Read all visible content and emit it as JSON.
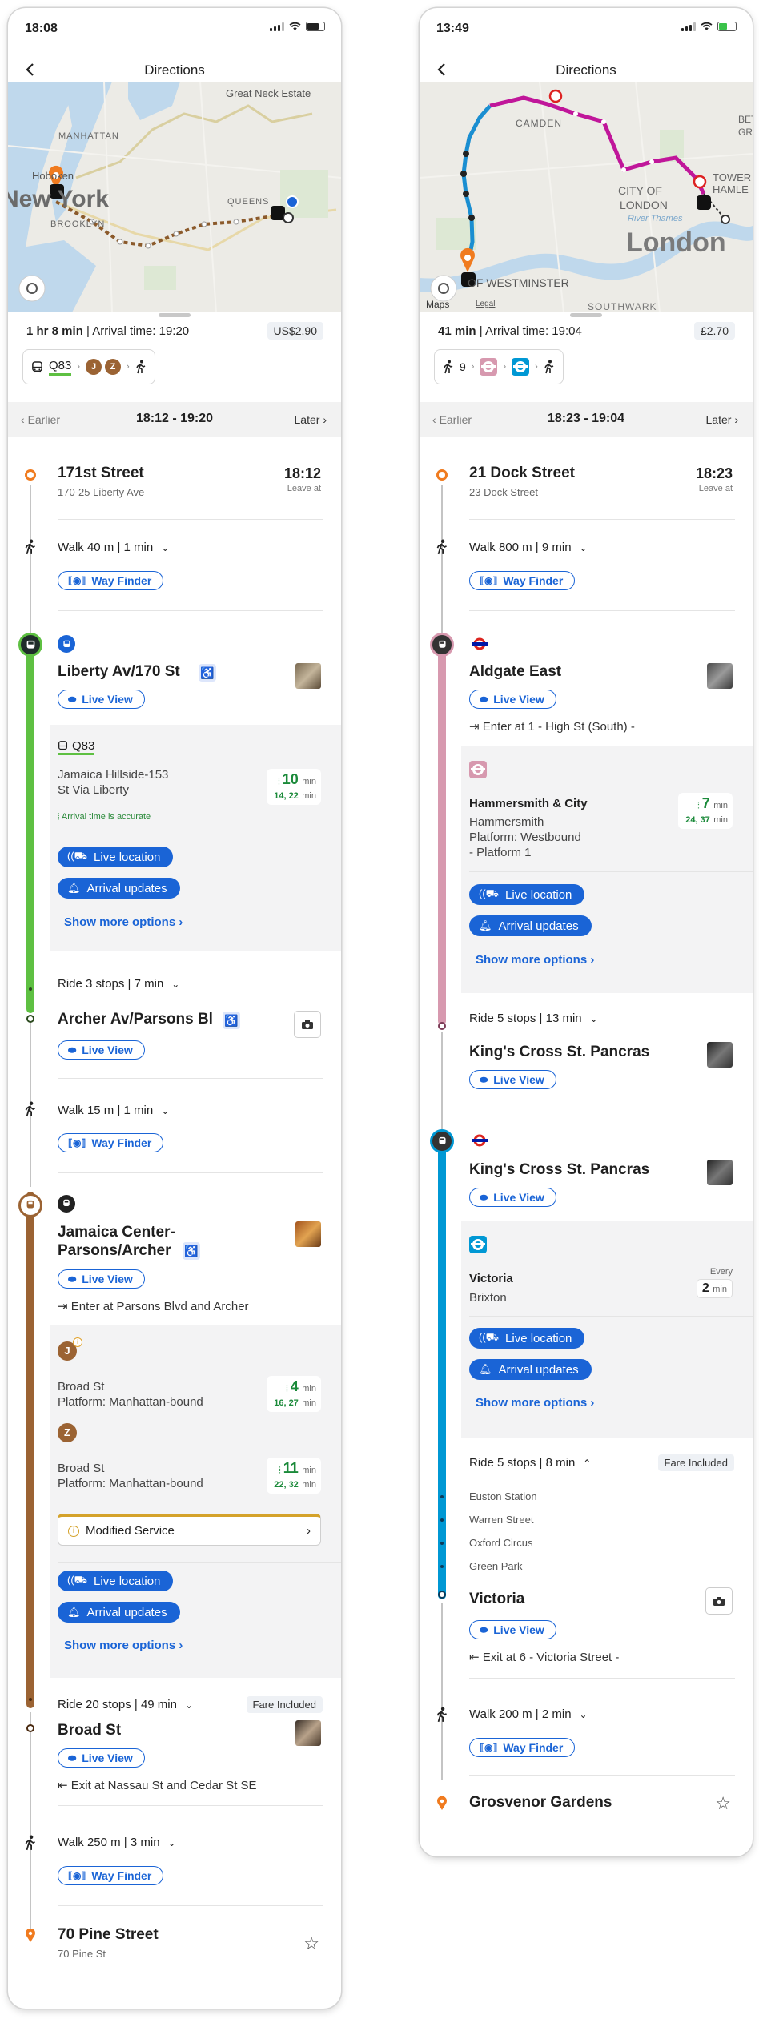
{
  "nyc": {
    "status_time": "18:08",
    "nav_title": "Directions",
    "map_labels": {
      "manhattan": "MANHATTAN",
      "hoboken": "Hoboken",
      "newyork": "New York",
      "brooklyn": "BROOKLYN",
      "queens": "QUEENS",
      "greatneck": "Great Neck Estate"
    },
    "summary_duration": "1 hr 8 min",
    "summary_arrival": "| Arrival time: 19:20",
    "price": "US$2.90",
    "mode_bus": "Q83",
    "mode_j": "J",
    "mode_z": "Z",
    "earlier": "Earlier",
    "window": "18:12 - 19:20",
    "later": "Later",
    "origin_name": "171st Street",
    "origin_addr": "170-25 Liberty Ave",
    "origin_time": "18:12",
    "leave_at": "Leave at",
    "walk1": "Walk 40 m | 1 min",
    "way_finder": "Way Finder",
    "stop1": "Liberty Av/170 St",
    "live_view": "Live View",
    "bus_route": "Q83",
    "bus_dest_line1": "Jamaica Hillside-153",
    "bus_dest_line2": "St Via Liberty",
    "bus_accuracy": "Arrival time is accurate",
    "bus_rt": "10",
    "bus_next": "14, 22",
    "min": "min",
    "live_location": "Live location",
    "arrival_updates": "Arrival updates",
    "show_more": "Show more options",
    "ride1": "Ride 3 stops | 7 min",
    "stop2": "Archer Av/Parsons Bl",
    "walk2": "Walk 15 m | 1 min",
    "stop3_line1": "Jamaica Center-",
    "stop3_line2": "Parsons/Archer",
    "enter_at": "Enter at Parsons Blvd and Archer",
    "j_dest": "Broad St",
    "j_platform": "Platform: Manhattan-bound",
    "j_rt": "4",
    "j_next": "16, 27",
    "z_dest": "Broad St",
    "z_platform": "Platform: Manhattan-bound",
    "z_rt": "11",
    "z_next": "22, 32",
    "modified": "Modified Service",
    "ride2": "Ride 20 stops | 49 min",
    "fare_included": "Fare Included",
    "stop4": "Broad St",
    "exit_at": "Exit at Nassau St and Cedar St SE",
    "walk3": "Walk 250 m | 3 min",
    "dest_name": "70 Pine Street",
    "dest_addr": "70 Pine St",
    "colors": {
      "bus": "#5ec042",
      "subway": "#9b6333",
      "blue": "#1a64d6",
      "orange": "#f07b1f"
    }
  },
  "ldn": {
    "status_time": "13:49",
    "nav_title": "Directions",
    "map_labels": {
      "camden": "CAMDEN",
      "city": "CITY OF",
      "london_small": "LONDON",
      "london": "London",
      "westminster": "OF WESTMINSTER",
      "thames": "River Thames",
      "hamlets": "TOWER HAMLE",
      "southwark": "SOUTHWARK",
      "maps": "Maps",
      "legal": "Legal",
      "bet": "BET",
      "gr": "GR"
    },
    "summary_duration": "41 min",
    "summary_arrival": "| Arrival time: 19:04",
    "price": "£2.70",
    "walk_count": "9",
    "earlier": "Earlier",
    "window": "18:23 - 19:04",
    "later": "Later",
    "origin_name": "21 Dock Street",
    "origin_addr": "23 Dock Street",
    "origin_time": "18:23",
    "leave_at": "Leave at",
    "walk1": "Walk 800 m | 9 min",
    "way_finder": "Way Finder",
    "stop1": "Aldgate East",
    "live_view": "Live View",
    "enter_at": "Enter at 1 - High St (South) -",
    "hc_line": "Hammersmith & City",
    "hc_dest1": "Hammersmith",
    "hc_dest2": "Platform: Westbound",
    "hc_dest3": "- Platform 1",
    "hc_rt": "7",
    "hc_next": "24, 37",
    "min": "min",
    "live_location": "Live location",
    "arrival_updates": "Arrival updates",
    "show_more": "Show more options",
    "ride1": "Ride 5 stops | 13 min",
    "stop2": "King's Cross St. Pancras",
    "stop3": "King's Cross St. Pancras",
    "vic_line": "Victoria",
    "vic_dest": "Brixton",
    "every": "Every",
    "every_val": "2",
    "every_unit": "min",
    "ride2": "Ride 5 stops | 8 min",
    "fare_included": "Fare Included",
    "intermediate": [
      "Euston Station",
      "Warren Street",
      "Oxford Circus",
      "Green Park"
    ],
    "stop4": "Victoria",
    "exit_at": "Exit at 6 - Victoria Street -",
    "walk2": "Walk 200 m | 2 min",
    "dest_name": "Grosvenor Gardens",
    "colors": {
      "hammersmith": "#d799af",
      "victoria": "#0098d4",
      "blue": "#1a64d6",
      "orange": "#f07b1f"
    }
  }
}
